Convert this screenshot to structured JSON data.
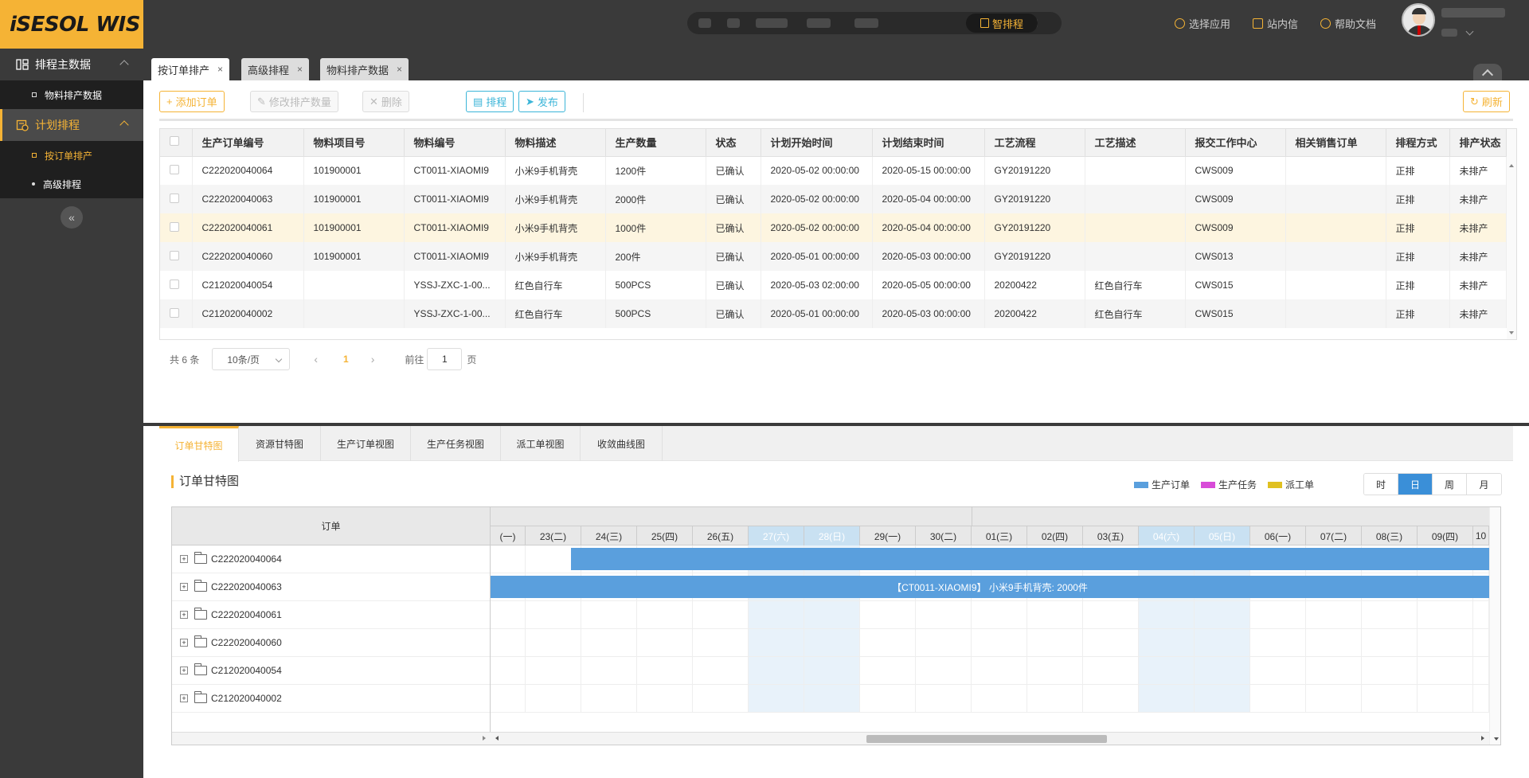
{
  "app": {
    "logo": "iSESOL WIS"
  },
  "sidebar": {
    "groups": [
      {
        "label": "排程主数据",
        "items": [
          {
            "label": "物料排产数据"
          }
        ]
      },
      {
        "label": "计划排程",
        "items": [
          {
            "label": "按订单排产"
          },
          {
            "label": "高级排程"
          }
        ]
      }
    ],
    "collapse_glyph": "«"
  },
  "header": {
    "smart_label": "智排程",
    "links": [
      {
        "label": "选择应用",
        "icon": "apps-icon"
      },
      {
        "label": "站内信",
        "icon": "mail-icon"
      },
      {
        "label": "帮助文档",
        "icon": "help-icon"
      }
    ]
  },
  "tabs": [
    {
      "label": "按订单排产",
      "close": "×"
    },
    {
      "label": "高级排程",
      "close": "×"
    },
    {
      "label": "物料排产数据",
      "close": "×"
    }
  ],
  "toolbar": {
    "add": "添加订单",
    "modify": "修改排产数量",
    "delete": "删除",
    "schedule": "排程",
    "publish": "发布",
    "refresh": "刷新",
    "add_glyph": "+",
    "modify_glyph": "✎",
    "delete_glyph": "✕",
    "schedule_glyph": "▤",
    "publish_glyph": "➤",
    "refresh_glyph": "↻"
  },
  "table": {
    "columns": [
      "生产订单编号",
      "物料项目号",
      "物料编号",
      "物料描述",
      "生产数量",
      "状态",
      "计划开始时间",
      "计划结束时间",
      "工艺流程",
      "工艺描述",
      "报交工作中心",
      "相关销售订单",
      "排程方式",
      "排产状态"
    ],
    "rows": [
      [
        "C222020040064",
        "101900001",
        "CT0011-XIAOMI9",
        "小米9手机背壳",
        "1200件",
        "已确认",
        "2020-05-02 00:00:00",
        "2020-05-15 00:00:00",
        "GY20191220",
        "",
        "CWS009",
        "",
        "正排",
        "未排产"
      ],
      [
        "C222020040063",
        "101900001",
        "CT0011-XIAOMI9",
        "小米9手机背壳",
        "2000件",
        "已确认",
        "2020-05-02 00:00:00",
        "2020-05-04 00:00:00",
        "GY20191220",
        "",
        "CWS009",
        "",
        "正排",
        "未排产"
      ],
      [
        "C222020040061",
        "101900001",
        "CT0011-XIAOMI9",
        "小米9手机背壳",
        "1000件",
        "已确认",
        "2020-05-02 00:00:00",
        "2020-05-04 00:00:00",
        "GY20191220",
        "",
        "CWS009",
        "",
        "正排",
        "未排产"
      ],
      [
        "C222020040060",
        "101900001",
        "CT0011-XIAOMI9",
        "小米9手机背壳",
        "200件",
        "已确认",
        "2020-05-01 00:00:00",
        "2020-05-03 00:00:00",
        "GY20191220",
        "",
        "CWS013",
        "",
        "正排",
        "未排产"
      ],
      [
        "C212020040054",
        "",
        "YSSJ-ZXC-1-00...",
        "红色自行车",
        "500PCS",
        "已确认",
        "2020-05-03 02:00:00",
        "2020-05-05 00:00:00",
        "20200422",
        "红色自行车",
        "CWS015",
        "",
        "正排",
        "未排产"
      ],
      [
        "C212020040002",
        "",
        "YSSJ-ZXC-1-00...",
        "红色自行车",
        "500PCS",
        "已确认",
        "2020-05-01 00:00:00",
        "2020-05-03 00:00:00",
        "20200422",
        "红色自行车",
        "CWS015",
        "",
        "正排",
        "未排产"
      ]
    ],
    "selected_row": 2
  },
  "pager": {
    "total": "共 6 条",
    "page_size": "10条/页",
    "prev": "‹",
    "next": "›",
    "current": "1",
    "goto_label": "前往",
    "goto_value": "1",
    "page_suffix": "页"
  },
  "views": {
    "tabs": [
      "订单甘特图",
      "资源甘特图",
      "生产订单视图",
      "生产任务视图",
      "派工单视图",
      "收敛曲线图"
    ],
    "active": 0
  },
  "gantt": {
    "title": "订单甘特图",
    "legend": [
      {
        "label": "生产订单",
        "color": "#5a9fdd"
      },
      {
        "label": "生产任务",
        "color": "#d84bd8"
      },
      {
        "label": "派工单",
        "color": "#e0c020"
      }
    ],
    "scales": [
      "时",
      "日",
      "周",
      "月"
    ],
    "active_scale": "日",
    "left_header": "订单",
    "days": [
      "(一)",
      "23(二)",
      "24(三)",
      "25(四)",
      "26(五)",
      "27(六)",
      "28(日)",
      "29(一)",
      "30(二)",
      "01(三)",
      "02(四)",
      "03(五)",
      "04(六)",
      "05(日)",
      "06(一)",
      "07(二)",
      "08(三)",
      "09(四)",
      "10"
    ],
    "weekend_days": [
      5,
      6,
      12,
      13
    ],
    "orders": [
      "C222020040064",
      "C222020040063",
      "C222020040061",
      "C222020040060",
      "C212020040054",
      "C212020040002"
    ],
    "bars": [
      {
        "row": 0,
        "label": ""
      },
      {
        "row": 1,
        "label": "【CT0011-XIAOMI9】 小米9手机背壳: 2000件"
      }
    ]
  }
}
